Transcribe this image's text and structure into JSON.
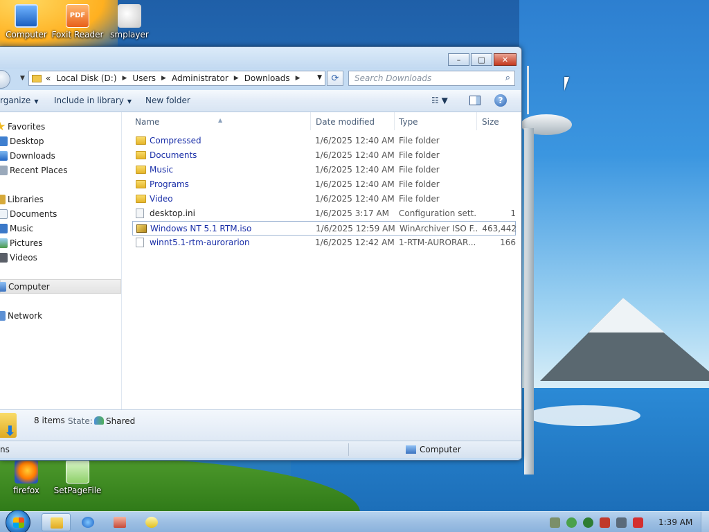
{
  "desktop": {
    "icons_top": [
      {
        "label": "Computer",
        "icon": "computer-icon"
      },
      {
        "label": "Foxit Reader",
        "icon": "pdf-icon",
        "glyph": "PDF"
      },
      {
        "label": "smplayer",
        "icon": "smplayer-icon"
      }
    ],
    "icons_bottom": [
      {
        "label": "firefox",
        "icon": "firefox-icon"
      },
      {
        "label": "SetPageFile",
        "icon": "setpagefile-icon"
      }
    ]
  },
  "window": {
    "caption_buttons": {
      "minimize": "–",
      "maximize": "□",
      "close": "✕"
    },
    "address": {
      "overflow": "«",
      "crumbs": [
        "Local Disk (D:)",
        "Users",
        "Administrator",
        "Downloads"
      ],
      "separator": "▶",
      "dropdown": "▼"
    },
    "refresh_glyph": "⟳",
    "search": {
      "placeholder": "Search Downloads",
      "icon": "search-icon",
      "glyph": "⌕"
    },
    "toolbar": {
      "organize": "rganize",
      "include_in_library": "Include in library",
      "new_folder": "New folder",
      "views_glyph": "☷ ▼",
      "help_glyph": "?"
    },
    "navpane": {
      "items": [
        {
          "label": "Favorites",
          "icon": "star-icon"
        },
        {
          "label": "Desktop",
          "icon": "desktop-icon"
        },
        {
          "label": "Downloads",
          "icon": "downloads-icon"
        },
        {
          "label": "Recent Places",
          "icon": "recent-places-icon"
        },
        {
          "label": "Libraries",
          "icon": "libraries-icon"
        },
        {
          "label": "Documents",
          "icon": "documents-icon"
        },
        {
          "label": "Music",
          "icon": "music-icon"
        },
        {
          "label": "Pictures",
          "icon": "pictures-icon"
        },
        {
          "label": "Videos",
          "icon": "videos-icon"
        },
        {
          "label": "Computer",
          "icon": "computer-icon"
        },
        {
          "label": "Network",
          "icon": "network-icon"
        }
      ]
    },
    "columns": {
      "name": "Name",
      "date_modified": "Date modified",
      "type": "Type",
      "size": "Size",
      "sort_glyph": "▲"
    },
    "files": [
      {
        "name": "Compressed",
        "date": "1/6/2025 12:40 AM",
        "type": "File folder",
        "size": "",
        "kind": "folder"
      },
      {
        "name": "Documents",
        "date": "1/6/2025 12:40 AM",
        "type": "File folder",
        "size": "",
        "kind": "folder"
      },
      {
        "name": "Music",
        "date": "1/6/2025 12:40 AM",
        "type": "File folder",
        "size": "",
        "kind": "folder"
      },
      {
        "name": "Programs",
        "date": "1/6/2025 12:40 AM",
        "type": "File folder",
        "size": "",
        "kind": "folder"
      },
      {
        "name": "Video",
        "date": "1/6/2025 12:40 AM",
        "type": "File folder",
        "size": "",
        "kind": "folder"
      },
      {
        "name": "desktop.ini",
        "date": "1/6/2025 3:17 AM",
        "type": "Configuration sett...",
        "size": "1",
        "kind": "ini"
      },
      {
        "name": "Windows NT 5.1 RTM.iso",
        "date": "1/6/2025 12:59 AM",
        "type": "WinArchiver ISO F...",
        "size": "463,442",
        "kind": "iso"
      },
      {
        "name": "winnt5.1-rtm-aurorarion",
        "date": "1/6/2025 12:42 AM",
        "type": "1-RTM-AURORAR...",
        "size": "166",
        "kind": "file"
      }
    ],
    "scrollbar": {
      "left": "◀",
      "right": "▶",
      "grip": "|||"
    },
    "details": {
      "count": "8 items",
      "state_label": "State:",
      "state_value": "Shared",
      "arrow": "⬇"
    },
    "statusbar": {
      "left_text": "ns",
      "right_text": "Computer"
    }
  },
  "taskbar": {
    "buttons": [
      {
        "name": "windows-explorer",
        "active": true
      },
      {
        "name": "internet-explorer",
        "active": false
      },
      {
        "name": "app-3",
        "active": false
      },
      {
        "name": "app-4",
        "active": false
      }
    ],
    "clock": "1:39 AM"
  }
}
